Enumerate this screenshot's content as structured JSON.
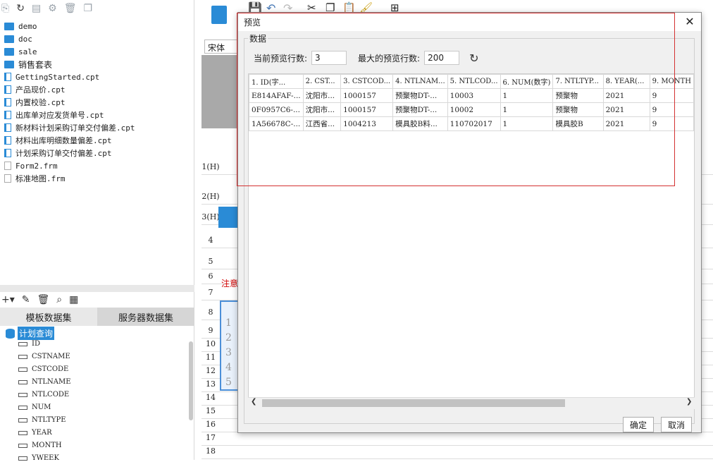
{
  "file_tree": [
    {
      "type": "folder",
      "name": "demo"
    },
    {
      "type": "folder",
      "name": "doc"
    },
    {
      "type": "folder",
      "name": "sale"
    },
    {
      "type": "folder",
      "name": "销售套表"
    },
    {
      "type": "cpt",
      "name": "GettingStarted.cpt"
    },
    {
      "type": "cpt",
      "name": "产品现价.cpt"
    },
    {
      "type": "cpt",
      "name": "内置校验.cpt"
    },
    {
      "type": "cpt",
      "name": "出库单对应发货单号.cpt"
    },
    {
      "type": "cpt",
      "name": "新材料计划采购订单交付偏差.cpt"
    },
    {
      "type": "cpt",
      "name": "材料出库明细数量偏差.cpt"
    },
    {
      "type": "cpt",
      "name": "计划采购订单交付偏差.cpt"
    },
    {
      "type": "frm",
      "name": "Form2.frm"
    },
    {
      "type": "frm",
      "name": "标准地图.frm"
    }
  ],
  "dataset_tabs": {
    "template": "模板数据集",
    "server": "服务器数据集"
  },
  "dataset": {
    "name": "计划查询",
    "fields": [
      "ID",
      "CSTNAME",
      "CSTCODE",
      "NTLNAME",
      "NTLCODE",
      "NUM",
      "NTLTYPE",
      "YEAR",
      "MONTH",
      "YWEEK"
    ]
  },
  "editor": {
    "font": "宋体",
    "row_headers": [
      "1(H)",
      "2(H)",
      "3(H)",
      "4",
      "5",
      "6",
      "7",
      "8",
      "9",
      "10",
      "11",
      "12",
      "13",
      "14",
      "15",
      "16",
      "17",
      "18"
    ],
    "note": "注意",
    "selected_nums": [
      "1",
      "2",
      "3",
      "4",
      "5"
    ]
  },
  "dialog": {
    "title": "预览",
    "group_label": "数据",
    "current_rows_label": "当前预览行数:",
    "current_rows_value": "3",
    "max_rows_label": "最大的预览行数:",
    "max_rows_value": "200",
    "ok": "确定",
    "cancel": "取消",
    "columns": [
      "1. ID(字...",
      "2. CST...",
      "3. CSTCOD...",
      "4. NTLNAM...",
      "5. NTLCOD...",
      "6. NUM(数字)",
      "7. NTLTYP...",
      "8. YEAR(...",
      "9. MONTH"
    ],
    "rows": [
      [
        "E814AFAF-...",
        "沈阳市...",
        "1000157",
        "预聚物DT-...",
        "10003",
        "1",
        "预聚物",
        "2021",
        "9"
      ],
      [
        "0F0957C6-...",
        "沈阳市...",
        "1000157",
        "预聚物DT-...",
        "10002",
        "1",
        "预聚物",
        "2021",
        "9"
      ],
      [
        "1A56678C-...",
        "江西省...",
        "1004213",
        "模具胶B料...",
        "110702017",
        "1",
        "模具胶B",
        "2021",
        "9"
      ]
    ]
  }
}
